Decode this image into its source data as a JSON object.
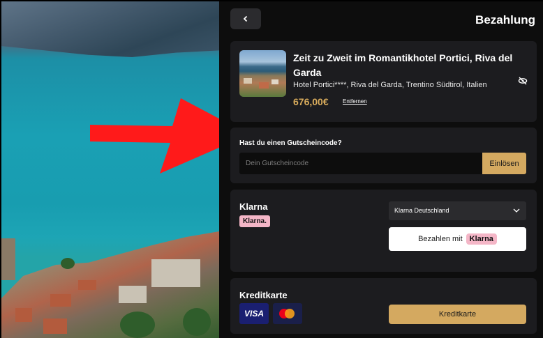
{
  "header": {
    "title": "Bezahlung",
    "back_icon": "chevron-left-icon"
  },
  "product": {
    "title": "Zeit zu Zweit im Romantikhotel Portici, Riva del Garda",
    "location": "Hotel Portici****, Riva del Garda, Trentino Südtirol, Italien",
    "price": "676,00€",
    "remove_label": "Entfernen",
    "visibility_icon": "eye-off-icon"
  },
  "voucher": {
    "label": "Hast du einen Gutscheincode?",
    "placeholder": "Dein Gutscheincode",
    "value": "",
    "redeem_label": "Einlösen"
  },
  "klarna": {
    "title": "Klarna",
    "badge": "Klarna.",
    "country_selected": "Klarna Deutschland",
    "pay_label": "Bezahlen mit",
    "pay_brand": "Klarna"
  },
  "creditcard": {
    "title": "Kreditkarte",
    "visa_label": "VISA",
    "button_label": "Kreditkarte"
  },
  "colors": {
    "accent": "#d4a960",
    "price": "#d9ac5c",
    "klarna_pink": "#f4b6c7",
    "panel_bg": "#0d0d0d",
    "card_bg": "#1c1c1f",
    "annotation_arrow": "#ff1a1a"
  }
}
